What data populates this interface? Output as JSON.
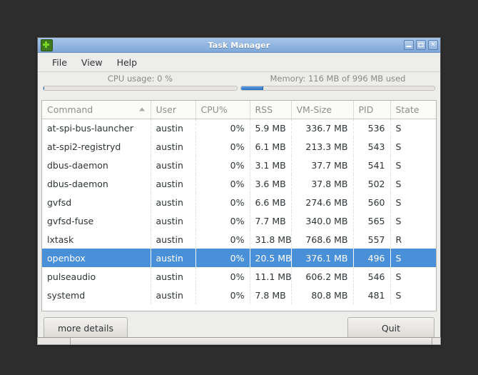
{
  "window": {
    "title": "Task Manager",
    "icon": "task-manager-icon",
    "controls": {
      "minimize": "minimize-icon",
      "maximize": "maximize-icon",
      "close": "×"
    }
  },
  "menu": {
    "items": [
      {
        "label": "File"
      },
      {
        "label": "View"
      },
      {
        "label": "Help"
      }
    ]
  },
  "meters": {
    "cpu": {
      "label": "CPU usage: 0 %",
      "percent": 0
    },
    "memory": {
      "label": "Memory: 116 MB of 996 MB used",
      "percent": 11.6,
      "used_mb": 116,
      "total_mb": 996
    }
  },
  "table": {
    "columns": [
      {
        "label": "Command",
        "sorted": "asc",
        "align": "left"
      },
      {
        "label": "User",
        "align": "left"
      },
      {
        "label": "CPU%",
        "align": "right"
      },
      {
        "label": "RSS",
        "align": "right"
      },
      {
        "label": "VM-Size",
        "align": "right"
      },
      {
        "label": "PID",
        "align": "right"
      },
      {
        "label": "State",
        "align": "left"
      }
    ],
    "rows": [
      {
        "command": "at-spi-bus-launcher",
        "user": "austin",
        "cpu": "0%",
        "rss": "5.9 MB",
        "vmsize": "336.7 MB",
        "pid": "536",
        "state": "S",
        "selected": false
      },
      {
        "command": "at-spi2-registryd",
        "user": "austin",
        "cpu": "0%",
        "rss": "6.1 MB",
        "vmsize": "213.3 MB",
        "pid": "543",
        "state": "S",
        "selected": false
      },
      {
        "command": "dbus-daemon",
        "user": "austin",
        "cpu": "0%",
        "rss": "3.1 MB",
        "vmsize": "37.7 MB",
        "pid": "541",
        "state": "S",
        "selected": false
      },
      {
        "command": "dbus-daemon",
        "user": "austin",
        "cpu": "0%",
        "rss": "3.6 MB",
        "vmsize": "37.8 MB",
        "pid": "502",
        "state": "S",
        "selected": false
      },
      {
        "command": "gvfsd",
        "user": "austin",
        "cpu": "0%",
        "rss": "6.6 MB",
        "vmsize": "274.6 MB",
        "pid": "560",
        "state": "S",
        "selected": false
      },
      {
        "command": "gvfsd-fuse",
        "user": "austin",
        "cpu": "0%",
        "rss": "7.7 MB",
        "vmsize": "340.0 MB",
        "pid": "565",
        "state": "S",
        "selected": false
      },
      {
        "command": "lxtask",
        "user": "austin",
        "cpu": "0%",
        "rss": "31.8 MB",
        "vmsize": "768.6 MB",
        "pid": "557",
        "state": "R",
        "selected": false
      },
      {
        "command": "openbox",
        "user": "austin",
        "cpu": "0%",
        "rss": "20.5 MB",
        "vmsize": "376.1 MB",
        "pid": "496",
        "state": "S",
        "selected": true
      },
      {
        "command": "pulseaudio",
        "user": "austin",
        "cpu": "0%",
        "rss": "11.1 MB",
        "vmsize": "606.2 MB",
        "pid": "546",
        "state": "S",
        "selected": false
      },
      {
        "command": "systemd",
        "user": "austin",
        "cpu": "0%",
        "rss": "7.8 MB",
        "vmsize": "80.8 MB",
        "pid": "481",
        "state": "S",
        "selected": false
      }
    ]
  },
  "footer": {
    "more_details_label": "more details",
    "quit_label": "Quit"
  },
  "colors": {
    "selection": "#4a90d9",
    "titlebar": "#95b8e2",
    "meter_fill": "#2a72c4",
    "desktop": "#2d2d2d"
  }
}
